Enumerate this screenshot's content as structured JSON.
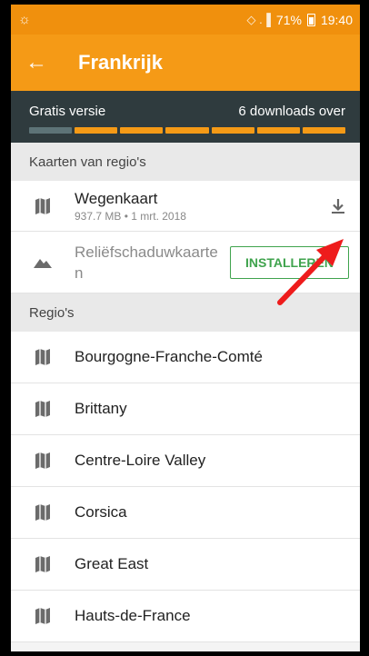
{
  "status_bar": {
    "left_icon": "brightness-icon",
    "signal": "◇ .▐",
    "battery_percent": "71%",
    "time": "19:40"
  },
  "app_bar": {
    "back_icon": "←",
    "title": "Frankrijk"
  },
  "downloads": {
    "version_label": "Gratis versie",
    "remaining_label": "6 downloads over",
    "total_slots": 7,
    "used_slots": 1
  },
  "maps_section": {
    "header": "Kaarten van regio's",
    "items": [
      {
        "name": "Wegenkaart",
        "meta": "937.7 MB • 1 mrt. 2018",
        "icon": "map-icon",
        "action_icon": "download-icon"
      },
      {
        "name": "Reliëfschaduwkaarte n",
        "icon": "mountain-icon",
        "action_label": "INSTALLEREN"
      }
    ]
  },
  "regions_section": {
    "header": "Regio's",
    "items": [
      {
        "name": "Bourgogne-Franche-Comté"
      },
      {
        "name": "Brittany"
      },
      {
        "name": "Centre-Loire Valley"
      },
      {
        "name": "Corsica"
      },
      {
        "name": "Great East"
      },
      {
        "name": "Hauts-de-France"
      }
    ]
  },
  "colors": {
    "accent": "#f59a16",
    "dark_panel": "#2f3b3e",
    "install_green": "#3fa34d",
    "annotation_arrow": "#ee1c1c"
  }
}
